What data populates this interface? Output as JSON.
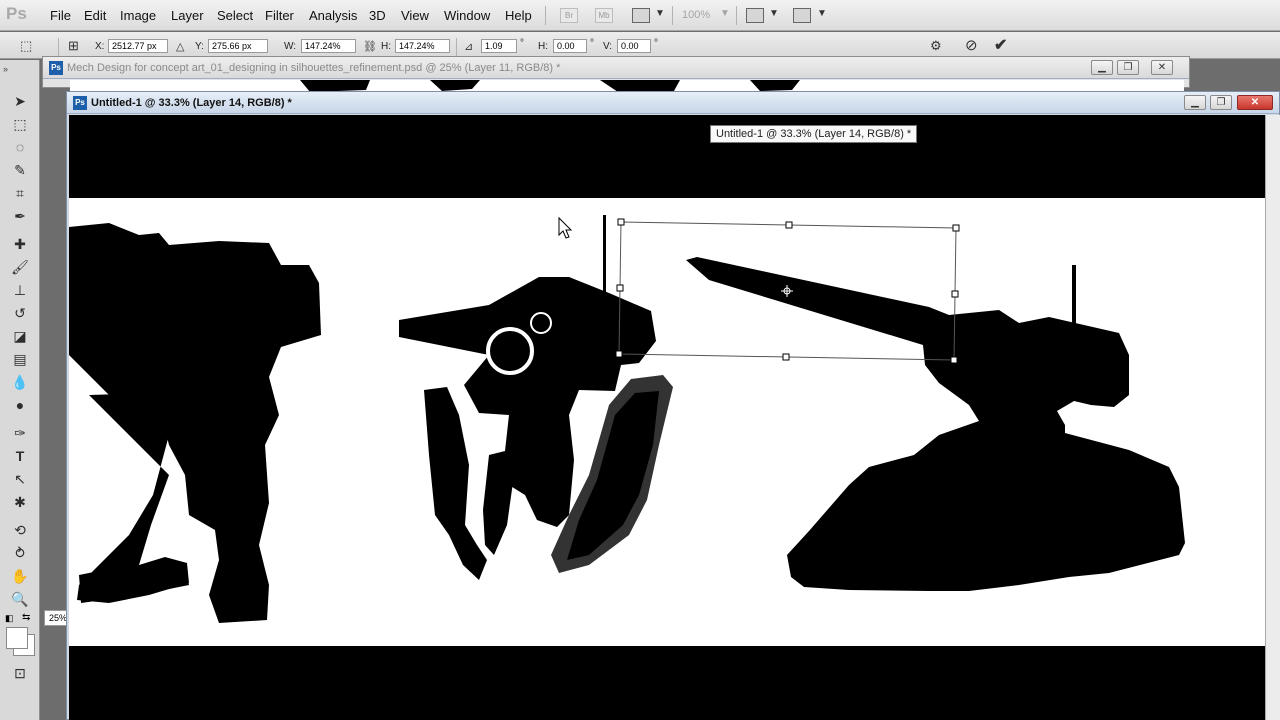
{
  "app": {
    "logo": "Ps"
  },
  "menu": [
    "File",
    "Edit",
    "Image",
    "Layer",
    "Select",
    "Filter",
    "Analysis",
    "3D",
    "View",
    "Window",
    "Help"
  ],
  "menubar_icons": {
    "bridge": "Br",
    "minibridge": "Mb",
    "zoom_level": "100%"
  },
  "options": {
    "x_label": "X:",
    "x_value": "2512.77 px",
    "y_label": "Y:",
    "y_value": "275.66 px",
    "w_label": "W:",
    "w_value": "147.24%",
    "h_label": "H:",
    "h_value": "147.24%",
    "angle_value": "1.09",
    "angle_unit": "°",
    "skew_h_label": "H:",
    "skew_h_value": "0.00",
    "skew_v_label": "V:",
    "skew_v_value": "0.00"
  },
  "documents": {
    "background_title": "Mech Design for concept art_01_designing in silhouettes_refinement.psd @ 25% (Layer 11, RGB/8) *",
    "active_title": "Untitled-1 @ 33.3% (Layer 14, RGB/8) *",
    "tooltip": "Untitled-1 @ 33.3% (Layer 14, RGB/8) *"
  },
  "zoom_indicator": "25%",
  "icons": [
    "move-tool-icon",
    "marquee-icon",
    "lasso-icon",
    "quick-select-icon",
    "crop-icon",
    "eyedropper-icon",
    "healing-icon",
    "brush-icon",
    "clone-stamp-icon",
    "history-brush-icon",
    "eraser-icon",
    "gradient-icon",
    "blur-icon",
    "dodge-icon",
    "pen-icon",
    "type-icon",
    "path-select-icon",
    "shape-icon",
    "3d-rotate-icon",
    "3d-orbit-icon",
    "hand-icon",
    "zoom-icon",
    "cancel-transform-icon",
    "commit-transform-icon"
  ],
  "colors": {
    "accent": "#1d5fa8",
    "close_button": "#c8372d",
    "foreground": "#000000",
    "background": "#ffffff"
  }
}
